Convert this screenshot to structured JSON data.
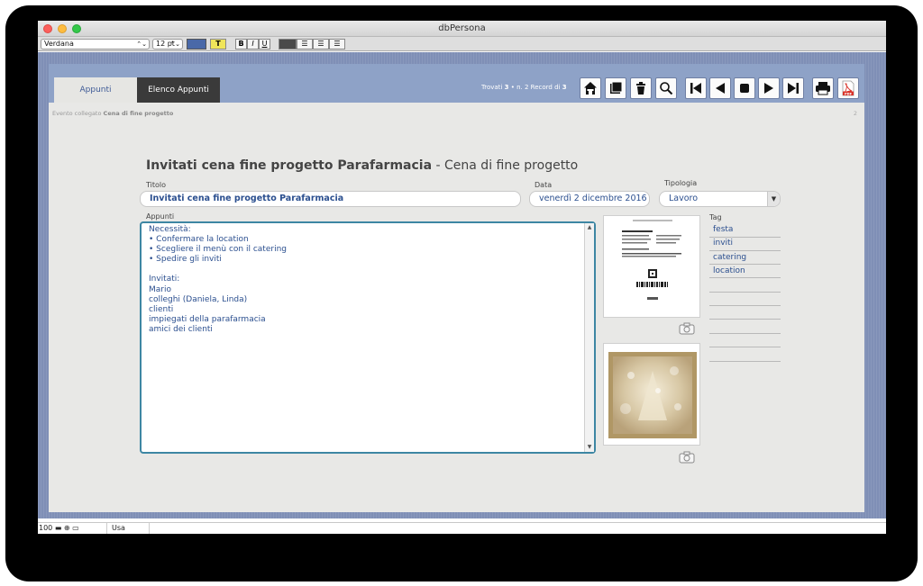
{
  "window": {
    "title": "dbPersona"
  },
  "format_bar": {
    "font": "Verdana",
    "size": "12 pt",
    "bold": "B",
    "italic": "I",
    "underline": "U",
    "text_color_button": "T"
  },
  "tabs": [
    {
      "label": "Appunti",
      "active": true
    },
    {
      "label": "Elenco Appunti",
      "active": false
    }
  ],
  "records": {
    "prefix": "Trovati",
    "found": "3",
    "middle": "• n. 2 Record di",
    "total": "3"
  },
  "toolbar": {
    "icons": [
      "home-icon",
      "duplicate-icon",
      "trash-icon",
      "search-icon",
      "first-record-icon",
      "previous-record-icon",
      "stop-icon",
      "next-record-icon",
      "last-record-icon",
      "print-icon",
      "pdf-icon"
    ],
    "pdf_label": "PDF"
  },
  "linked_event": {
    "prefix": "Evento collegato",
    "name": "Cena di fine progetto"
  },
  "page_number": "2",
  "heading": {
    "title": "Invitati cena fine progetto Parafarmacia",
    "separator": "-",
    "event": "Cena di fine progetto"
  },
  "form": {
    "titolo_label": "Titolo",
    "titolo_value": "Invitati cena fine progetto Parafarmacia",
    "data_label": "Data",
    "data_value": "venerdì 2 dicembre 2016",
    "tipologia_label": "Tipologia",
    "tipologia_value": "Lavoro",
    "appunti_label": "Appunti",
    "appunti_text": "Necessità:\n• Confermare la location\n• Scegliere il menù con il catering\n• Spedire gli inviti\n\nInvitati:\nMario\ncolleghi (Daniela, Linda)\nclienti\nimpiegati della parafarmacia\namici dei clienti",
    "tag_label": "Tag",
    "tags": [
      "festa",
      "inviti",
      "catering",
      "location"
    ]
  },
  "status_bar": {
    "zoom": "100",
    "mode": "Usa"
  },
  "colors": {
    "header": "#8ea2c7",
    "border": "#7f8fb6",
    "text_blue": "#2b4f8f",
    "notes_border": "#3d86a3",
    "dark_tab": "#3a3a3a"
  }
}
